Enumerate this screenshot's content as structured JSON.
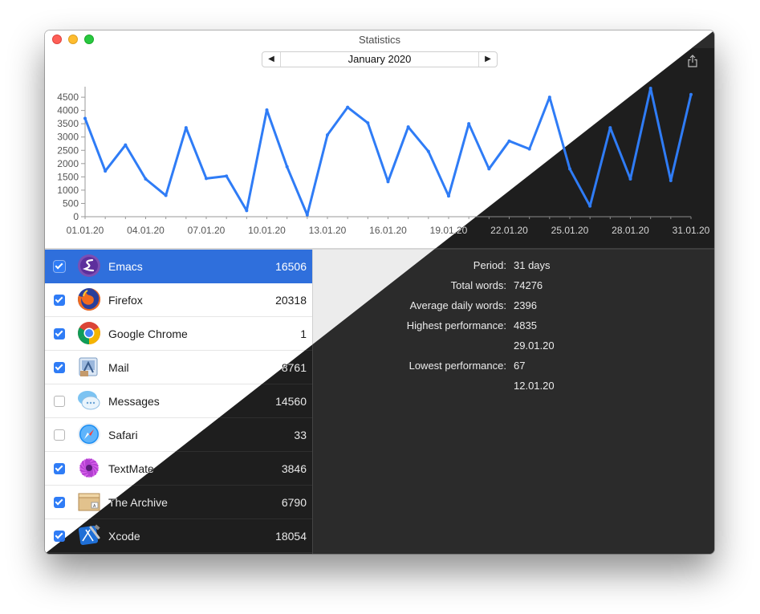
{
  "window": {
    "title": "Statistics"
  },
  "month_nav": {
    "prev": "◀",
    "label": "January 2020",
    "next": "▶"
  },
  "toolbar": {
    "share_icon": "share-icon"
  },
  "colors": {
    "line": "#2f7cf6",
    "selection": "#2f6fdc",
    "checkbox": "#2f7cf6"
  },
  "chart_data": {
    "type": "line",
    "x": [
      "01.01.20",
      "02.01.20",
      "03.01.20",
      "04.01.20",
      "05.01.20",
      "06.01.20",
      "07.01.20",
      "08.01.20",
      "09.01.20",
      "10.01.20",
      "11.01.20",
      "12.01.20",
      "13.01.20",
      "14.01.20",
      "15.01.20",
      "16.01.20",
      "17.01.20",
      "18.01.20",
      "19.01.20",
      "20.01.20",
      "21.01.20",
      "22.01.20",
      "23.01.20",
      "24.01.20",
      "25.01.20",
      "26.01.20",
      "27.01.20",
      "28.01.20",
      "29.01.20",
      "30.01.20",
      "31.01.20"
    ],
    "x_tick_labels": [
      "01.01.20",
      "04.01.20",
      "07.01.20",
      "10.01.20",
      "13.01.20",
      "16.01.20",
      "19.01.20",
      "22.01.20",
      "25.01.20",
      "28.01.20",
      "31.01.20"
    ],
    "series": [
      {
        "values": [
          3700,
          1720,
          2700,
          1420,
          800,
          3350,
          1440,
          1530,
          230,
          4020,
          1880,
          67,
          3080,
          4120,
          3530,
          1320,
          3380,
          2460,
          780,
          3500,
          1800,
          2850,
          2550,
          4500,
          1800,
          400,
          3350,
          1420,
          4835,
          1360,
          4600
        ]
      }
    ],
    "y_ticks": [
      0,
      500,
      1000,
      1500,
      2000,
      2500,
      3000,
      3500,
      4000,
      4500
    ],
    "ylim": [
      0,
      4835
    ],
    "grid": false
  },
  "apps": [
    {
      "name": "Emacs",
      "count": "16506",
      "checked": true,
      "selected": true,
      "icon": "emacs-icon"
    },
    {
      "name": "Firefox",
      "count": "20318",
      "checked": true,
      "selected": false,
      "icon": "firefox-icon"
    },
    {
      "name": "Google Chrome",
      "count": "1",
      "checked": true,
      "selected": false,
      "icon": "chrome-icon"
    },
    {
      "name": "Mail",
      "count": "8761",
      "checked": true,
      "selected": false,
      "icon": "mail-icon"
    },
    {
      "name": "Messages",
      "count": "14560",
      "checked": false,
      "selected": false,
      "icon": "messages-icon"
    },
    {
      "name": "Safari",
      "count": "33",
      "checked": false,
      "selected": false,
      "icon": "safari-icon"
    },
    {
      "name": "TextMate",
      "count": "3846",
      "checked": true,
      "selected": false,
      "icon": "textmate-icon"
    },
    {
      "name": "The Archive",
      "count": "6790",
      "checked": true,
      "selected": false,
      "icon": "the-archive-icon"
    },
    {
      "name": "Xcode",
      "count": "18054",
      "checked": true,
      "selected": false,
      "icon": "xcode-icon"
    }
  ],
  "stats": [
    {
      "label": "Period:",
      "value": "31 days"
    },
    {
      "label": "Total words:",
      "value": "74276"
    },
    {
      "label": "Average daily words:",
      "value": "2396"
    },
    {
      "label": "Highest performance:",
      "value": "4835"
    },
    {
      "label": "",
      "value": "29.01.20"
    },
    {
      "label": "Lowest performance:",
      "value": "67"
    },
    {
      "label": "",
      "value": "12.01.20"
    }
  ]
}
